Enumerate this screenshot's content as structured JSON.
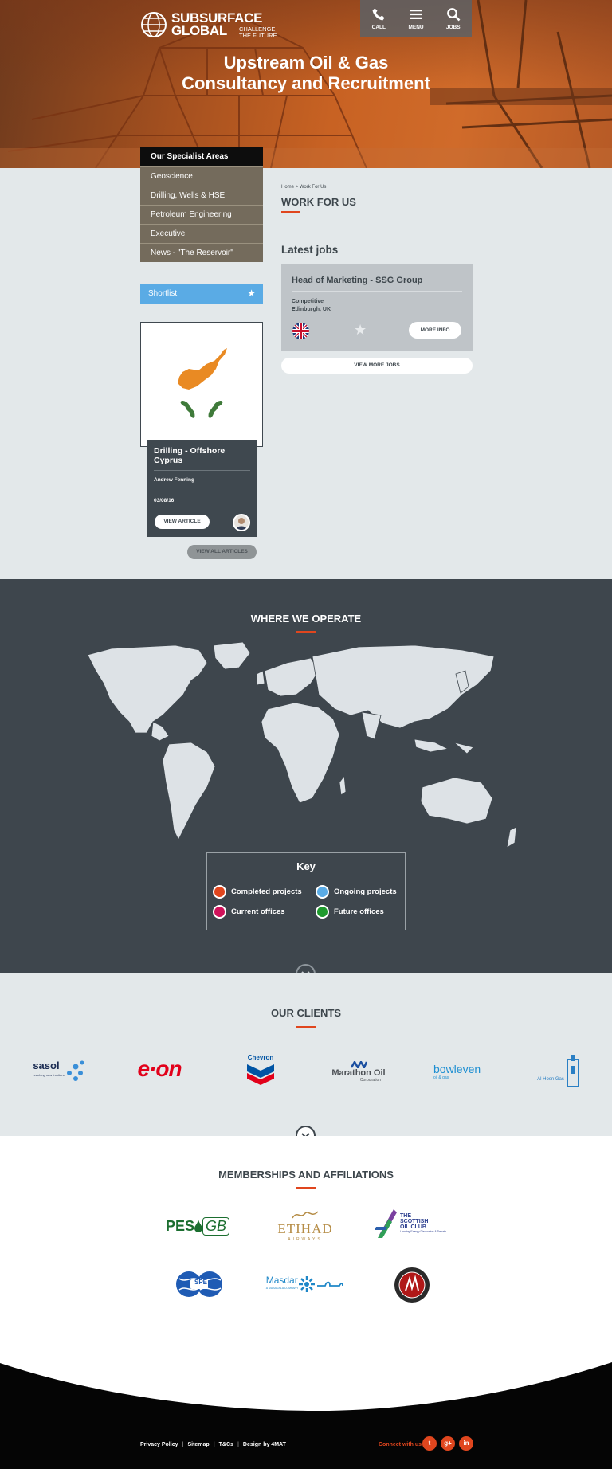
{
  "header": {
    "logo_line1": "SUBSURFACE",
    "logo_line2": "GLOBAL",
    "logo_tag1": "CHALLENGE",
    "logo_tag2": "THE FUTURE",
    "nav": [
      {
        "label": "CALL",
        "icon": "phone-icon"
      },
      {
        "label": "MENU",
        "icon": "menu-icon"
      },
      {
        "label": "JOBS",
        "icon": "search-icon"
      }
    ],
    "hero_line1": "Upstream Oil & Gas",
    "hero_line2": "Consultancy and Recruitment"
  },
  "sidebar": {
    "heading": "Our Specialist Areas",
    "items": [
      "Geoscience",
      "Drilling, Wells & HSE",
      "Petroleum Engineering",
      "Executive",
      "News - \"The Reservoir\""
    ],
    "shortlist_label": "Shortlist"
  },
  "article": {
    "title_line1": "Drilling - Offshore",
    "title_line2": "Cyprus",
    "author": "Andrew Fenning",
    "date": "03/08/16",
    "button": "VIEW ARTICLE",
    "view_all": "VIEW ALL ARTICLES"
  },
  "breadcrumb": {
    "home": "Home",
    "separator": ">",
    "current": "Work For Us"
  },
  "page_title": "WORK FOR US",
  "latest_jobs": {
    "heading": "Latest jobs",
    "job": {
      "title": "Head of Marketing - SSG Group",
      "salary": "Competitive",
      "location": "Edinburgh, UK",
      "flag": "uk-flag-icon",
      "more_info": "MORE INFO"
    },
    "view_more": "VIEW MORE JOBS"
  },
  "operate": {
    "heading": "WHERE WE OPERATE",
    "key_title": "Key",
    "key": [
      {
        "label": "Completed projects",
        "color": "#e0461e"
      },
      {
        "label": "Ongoing projects",
        "color": "#5aabe5"
      },
      {
        "label": "Current offices",
        "color": "#d0135b"
      },
      {
        "label": "Future offices",
        "color": "#1f9a2e"
      }
    ]
  },
  "clients": {
    "heading": "OUR CLIENTS",
    "logos": {
      "sasol": "sasol",
      "sasol_tag": "reaching new frontiers",
      "eon": "e·on",
      "chevron": "Chevron",
      "marathon": "Marathon Oil",
      "marathon_sub": "Corporation",
      "bowleven": "bowleven",
      "bowleven_sub": "oil & gas",
      "alhosn": "Al Hosn Gas"
    }
  },
  "memberships": {
    "heading": "MEMBERSHIPS AND AFFILIATIONS",
    "logos": {
      "pesgb_1": "PES",
      "pesgb_2": "GB",
      "etihad": "ETIHAD",
      "etihad_sub": "AIRWAYS",
      "soc_1": "THE",
      "soc_2": "SCOTTISH",
      "soc_3": "OIL CLUB",
      "soc_sub": "Leading Energy Discussion & Debate",
      "spe": "SPE",
      "masdar": "Masdar",
      "masdar_sub": "A MUBADALA COMPANY"
    }
  },
  "footer": {
    "links": [
      "Privacy Policy",
      "Sitemap",
      "T&Cs",
      "Design by 4MAT"
    ],
    "connect": "Connect with us",
    "social": [
      {
        "icon": "twitter-icon",
        "glyph": "t"
      },
      {
        "icon": "google-plus-icon",
        "glyph": "g+"
      },
      {
        "icon": "linkedin-icon",
        "glyph": "in"
      }
    ]
  }
}
